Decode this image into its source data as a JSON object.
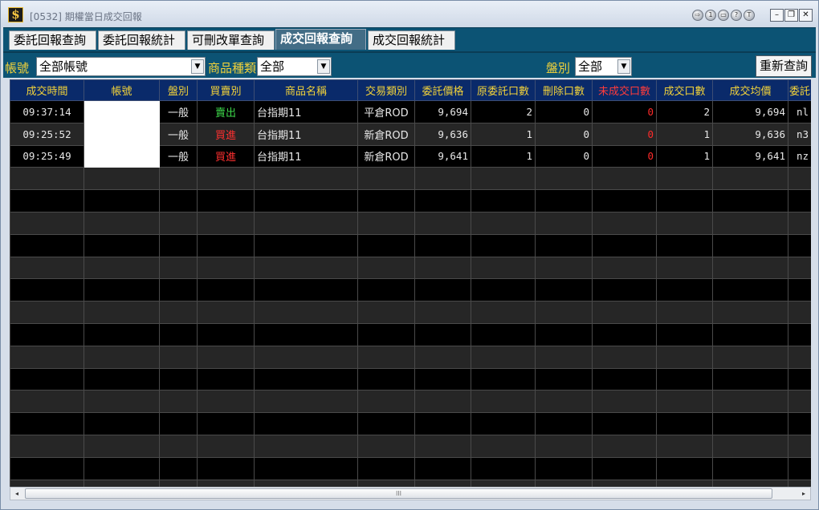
{
  "window": {
    "title": "[0532] 期權當日成交回報"
  },
  "titlebar_icons": [
    "⇨",
    "1",
    "▭",
    "?",
    "T"
  ],
  "window_buttons": {
    "minimize": "–",
    "maximize": "❐",
    "close": "✕"
  },
  "app_icon_glyph": "$",
  "tabs": [
    {
      "label": "委託回報查詢",
      "active": false
    },
    {
      "label": "委託回報統計",
      "active": false
    },
    {
      "label": "可刪改單查詢",
      "active": false
    },
    {
      "label": "成交回報查詢",
      "active": true
    },
    {
      "label": "成交回報統計",
      "active": false
    }
  ],
  "filters": {
    "account_label": "帳號",
    "account_value": "全部帳號",
    "product_label": "商品種類",
    "product_value": "全部",
    "market_label": "盤別",
    "market_value": "全部",
    "query_button": "重新查詢"
  },
  "table": {
    "columns": [
      "成交時間",
      "帳號",
      "盤別",
      "買賣別",
      "商品名稱",
      "交易類別",
      "委託價格",
      "原委託口數",
      "刪除口數",
      "未成交口數",
      "成交口數",
      "成交均價",
      "委託"
    ],
    "rows": [
      {
        "time": "09:37:14",
        "account": "",
        "session": "一般",
        "side": "賣出",
        "side_type": "sell",
        "product": "台指期11",
        "trade_type": "平倉ROD",
        "price": "9,694",
        "orig_qty": "2",
        "cancel_qty": "0",
        "unfilled_qty": "0",
        "filled_qty": "2",
        "avg_price": "9,694",
        "order_no": "nl"
      },
      {
        "time": "09:25:52",
        "account": "",
        "session": "一般",
        "side": "買進",
        "side_type": "buy",
        "product": "台指期11",
        "trade_type": "新倉ROD",
        "price": "9,636",
        "orig_qty": "1",
        "cancel_qty": "0",
        "unfilled_qty": "0",
        "filled_qty": "1",
        "avg_price": "9,636",
        "order_no": "n3"
      },
      {
        "time": "09:25:49",
        "account": "",
        "session": "一般",
        "side": "買進",
        "side_type": "buy",
        "product": "台指期11",
        "trade_type": "新倉ROD",
        "price": "9,641",
        "orig_qty": "1",
        "cancel_qty": "0",
        "unfilled_qty": "0",
        "filled_qty": "1",
        "avg_price": "9,641",
        "order_no": "nz"
      }
    ]
  },
  "scrollbar": {
    "left": "◂",
    "right": "▸",
    "grip": "III"
  }
}
